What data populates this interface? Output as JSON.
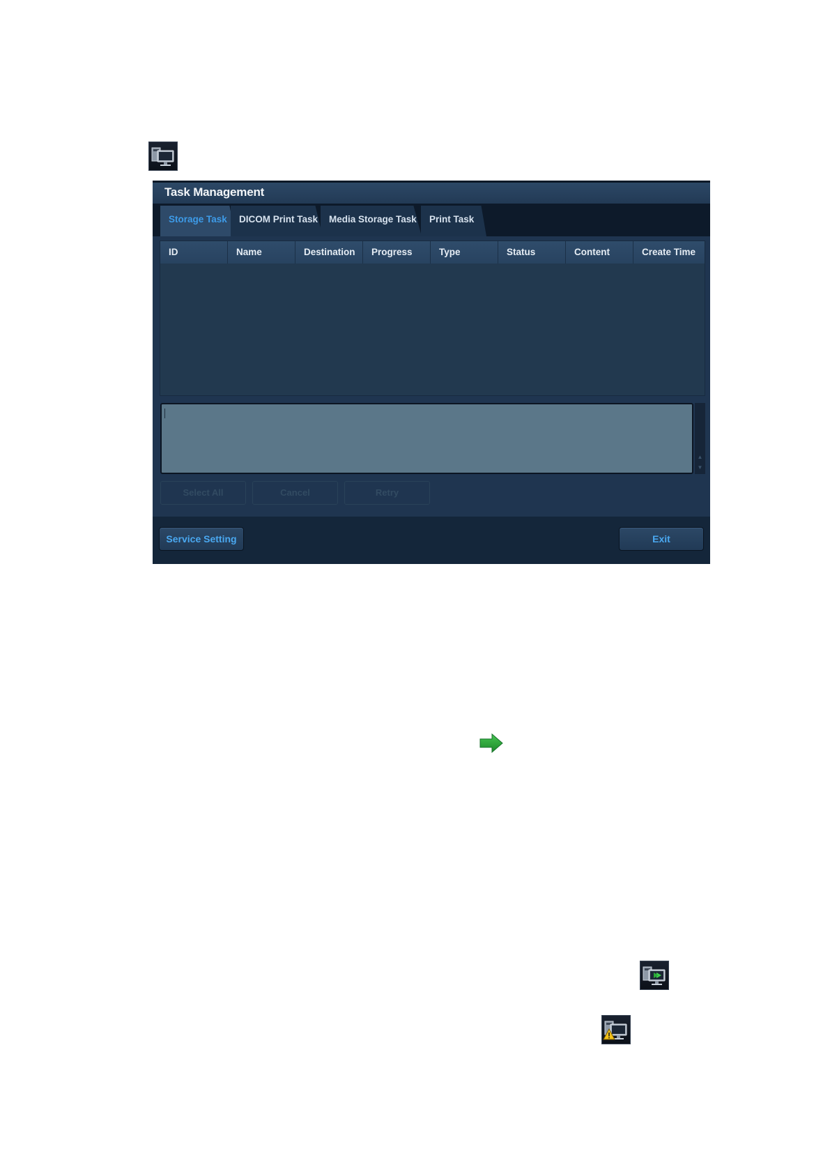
{
  "dialog": {
    "title": "Task Management",
    "tabs": [
      {
        "label": "Storage Task",
        "active": true
      },
      {
        "label": "DICOM Print Task",
        "active": false
      },
      {
        "label": "Media Storage Task",
        "active": false
      },
      {
        "label": "Print Task",
        "active": false
      }
    ],
    "table": {
      "columns": [
        "ID",
        "Name",
        "Destination",
        "Progress",
        "Type",
        "Status",
        "Content",
        "Create Time"
      ],
      "rows": []
    },
    "log_box": {
      "value": ""
    },
    "actions": {
      "select_all": "Select All",
      "cancel": "Cancel",
      "retry": "Retry"
    },
    "footer": {
      "service_setting": "Service Setting",
      "exit": "Exit"
    }
  },
  "icons": {
    "task_icon_idle": "task-manager-idle-icon",
    "arrow": "green-arrow-right-icon",
    "task_icon_running": "task-manager-running-icon",
    "task_icon_warning": "task-manager-warning-icon"
  },
  "colors": {
    "dialog_bg": "#1d3148",
    "active_tab_text": "#3d9be8",
    "footer_button_text": "#4aa8f0",
    "log_box_bg": "#5b7789",
    "arrow_green": "#2ea83a",
    "warning_yellow": "#f2c21b"
  }
}
